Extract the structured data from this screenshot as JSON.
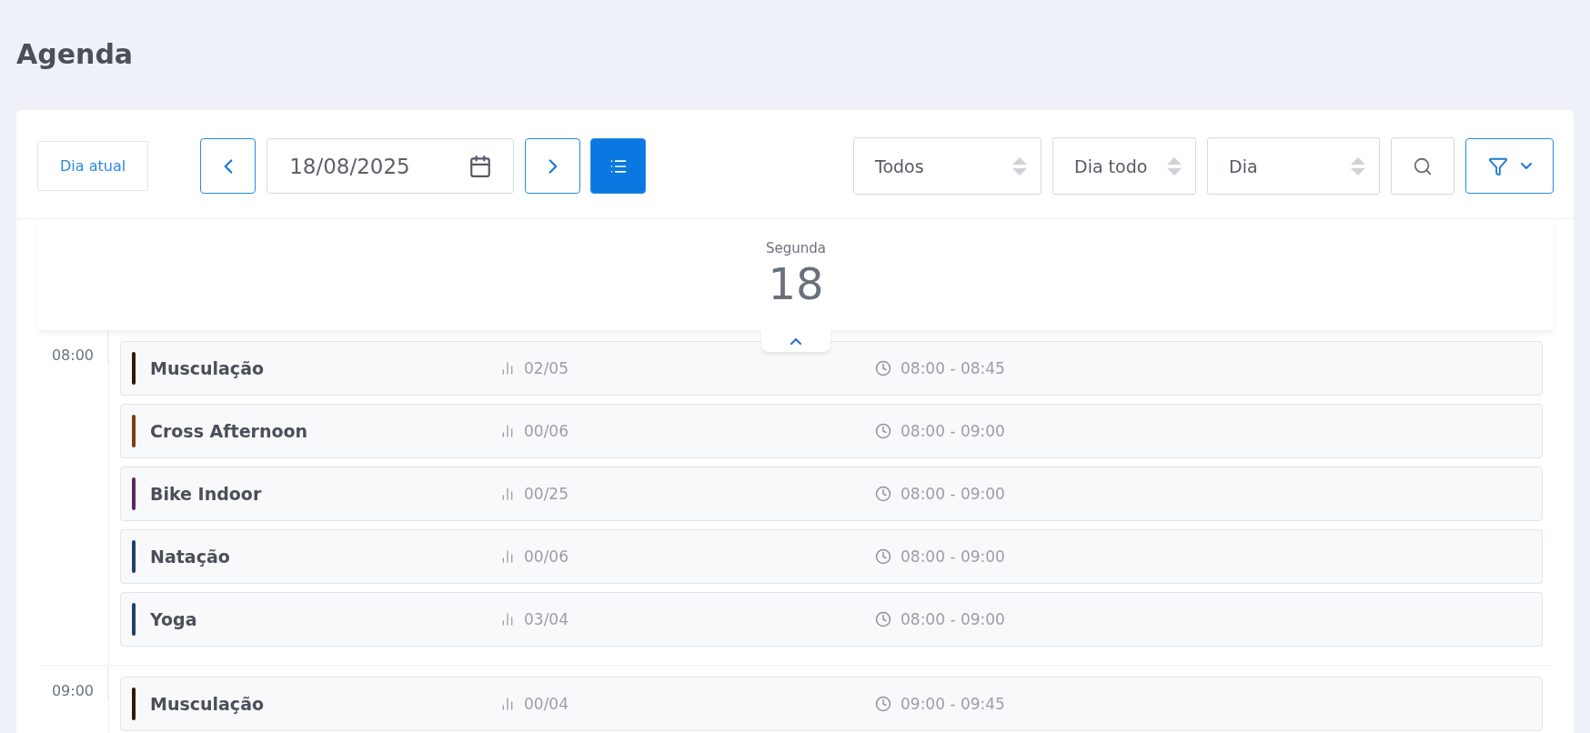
{
  "page_title": "Agenda",
  "toolbar": {
    "today_button": "Dia atual",
    "date": "18/08/2025",
    "list_view_active": true,
    "selects": [
      {
        "value": "Todos"
      },
      {
        "value": "Dia todo"
      },
      {
        "value": "Dia"
      }
    ]
  },
  "day_header": {
    "weekday": "Segunda",
    "day": "18"
  },
  "time_slots": [
    {
      "time": "08:00",
      "classes": [
        {
          "name": "Musculação",
          "capacity": "02/05",
          "hours": "08:00 - 08:45",
          "color": "#2e1a0e"
        },
        {
          "name": "Cross Afternoon",
          "capacity": "00/06",
          "hours": "08:00 - 09:00",
          "color": "#7a3e12"
        },
        {
          "name": "Bike Indoor",
          "capacity": "00/25",
          "hours": "08:00 - 09:00",
          "color": "#5a2a5e"
        },
        {
          "name": "Natação",
          "capacity": "00/06",
          "hours": "08:00 - 09:00",
          "color": "#1f3f66"
        },
        {
          "name": "Yoga",
          "capacity": "03/04",
          "hours": "08:00 - 09:00",
          "color": "#1f3f66"
        }
      ]
    },
    {
      "time": "09:00",
      "classes": [
        {
          "name": "Musculação",
          "capacity": "00/04",
          "hours": "09:00 - 09:45",
          "color": "#2e1a0e"
        }
      ]
    }
  ]
}
